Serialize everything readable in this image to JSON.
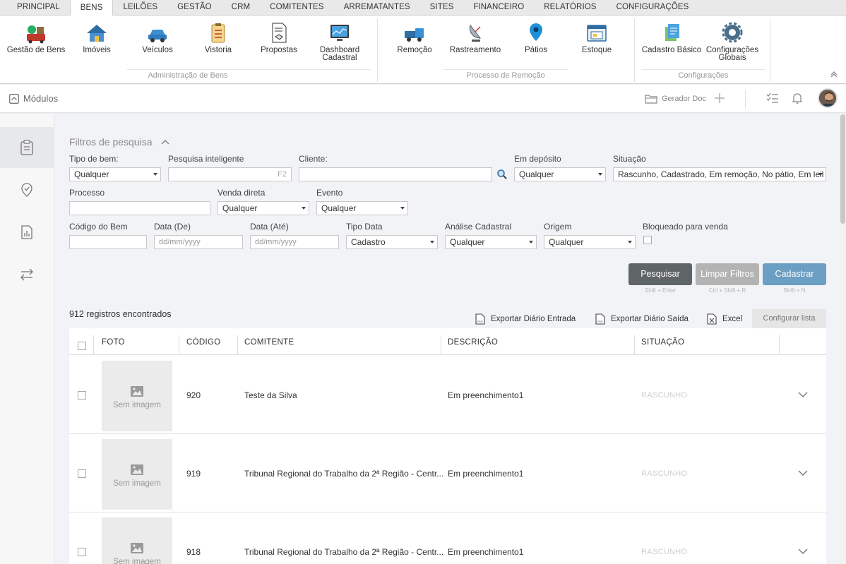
{
  "top_tabs": [
    "PRINCIPAL",
    "BENS",
    "LEILÕES",
    "GESTÃO",
    "CRM",
    "COMITENTES",
    "ARREMATANTES",
    "SITES",
    "FINANCEIRO",
    "RELATÓRIOS",
    "CONFIGURAÇÕES"
  ],
  "active_tab": "BENS",
  "ribbon": {
    "items": [
      {
        "label": "Gestão de Bens",
        "icon": "goods-pile-icon"
      },
      {
        "label": "Imóveis",
        "icon": "house-icon"
      },
      {
        "label": "Veículos",
        "icon": "car-icon"
      },
      {
        "label": "Vistoria",
        "icon": "clipboard-icon"
      },
      {
        "label": "Propostas",
        "icon": "handshake-doc-icon"
      },
      {
        "label": "Dashboard",
        "label2": "Cadastral",
        "icon": "dashboard-monitor-icon"
      },
      {
        "label": "Remoção",
        "icon": "tow-truck-icon"
      },
      {
        "label": "Rastreamento",
        "icon": "satellite-dish-icon"
      },
      {
        "label": "Pátios",
        "icon": "location-pin-icon"
      },
      {
        "label": "Estoque",
        "icon": "warehouse-icon"
      },
      {
        "label": "Cadastro Básico",
        "icon": "documents-icon"
      },
      {
        "label": "Configurações",
        "label2": "Globais",
        "icon": "gear-icon"
      }
    ],
    "groups": [
      "Administração de Bens",
      "Processo de Remoção",
      "Configurações"
    ]
  },
  "header": {
    "modulos": "Módulos",
    "gerador": "Gerador Doc"
  },
  "filters": {
    "title": "Filtros de pesquisa",
    "tipo_bem_label": "Tipo de bem:",
    "tipo_bem_value": "Qualquer",
    "pesquisa_label": "Pesquisa inteligente",
    "pesquisa_hint": "F2",
    "cliente_label": "Cliente:",
    "em_deposito_label": "Em depósito",
    "em_deposito_value": "Qualquer",
    "situacao_label": "Situação",
    "situacao_value": "Rascunho, Cadastrado, Em remoção, No pátio, Em leil",
    "processo_label": "Processo",
    "venda_direta_label": "Venda direta",
    "venda_direta_value": "Qualquer",
    "evento_label": "Evento",
    "evento_value": "Qualquer",
    "codigo_label": "Código do Bem",
    "data_de_label": "Data (De)",
    "data_de_placeholder": "dd/mm/yyyy",
    "data_ate_label": "Data (Até)",
    "data_ate_placeholder": "dd/mm/yyyy",
    "tipo_data_label": "Tipo Data",
    "tipo_data_value": "Cadastro",
    "analise_label": "Análise Cadastral",
    "analise_value": "Qualquer",
    "origem_label": "Origem",
    "origem_value": "Qualquer",
    "bloqueado_label": "Bloqueado para venda"
  },
  "buttons": {
    "pesquisar": "Pesquisar",
    "pesquisar_hint": "Shift + Enter",
    "limpar": "Limpar Filtros",
    "limpar_hint": "Ctrl + Shift + R",
    "cadastrar": "Cadastrar",
    "cadastrar_hint": "Shift + N"
  },
  "results": {
    "count_text": "912 registros encontrados",
    "export_entrada": "Exportar Diário Entrada",
    "export_saida": "Exportar Diário Saída",
    "excel": "Excel",
    "configurar": "Configurar lista"
  },
  "table": {
    "columns": [
      "FOTO",
      "CÓDIGO",
      "COMITENTE",
      "DESCRIÇÃO",
      "SITUAÇÃO"
    ],
    "no_image": "Sem imagem",
    "rows": [
      {
        "codigo": "920",
        "comitente": "Teste da Silva",
        "descricao": "Em preenchimento1",
        "situacao": "RASCUNHO"
      },
      {
        "codigo": "919",
        "comitente": "Tribunal Regional do Trabalho da 2ª Região - Centr...",
        "descricao": "Em preenchimento1",
        "situacao": "RASCUNHO"
      },
      {
        "codigo": "918",
        "comitente": "Tribunal Regional do Trabalho da 2ª Região - Centr...",
        "descricao": "Em preenchimento1",
        "situacao": "RASCUNHO"
      }
    ]
  },
  "colors": {
    "pesquisar": "#5f6466",
    "limpar": "#b3b3b3",
    "cadastrar": "#6a9ec2",
    "accent_blue": "#2e7fc1"
  }
}
